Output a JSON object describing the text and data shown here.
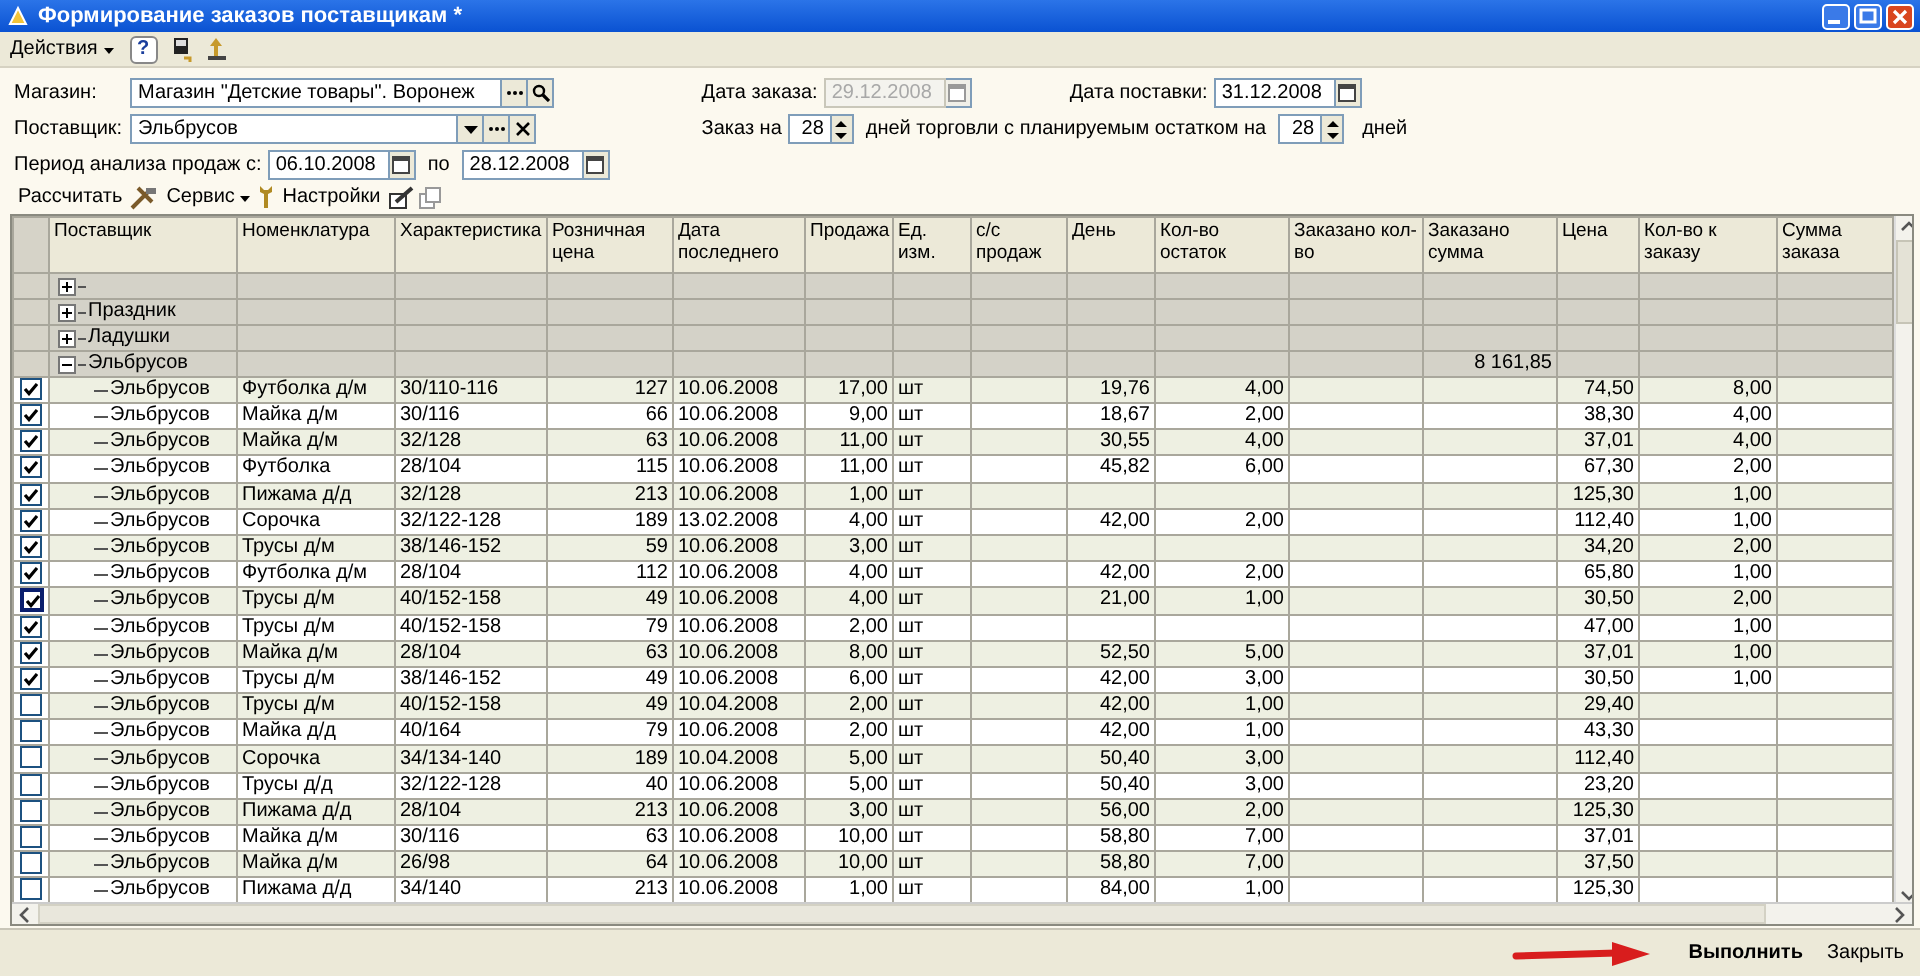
{
  "window": {
    "title": "Формирование заказов поставщикам *"
  },
  "menu": {
    "actions": "Действия",
    "help": "?"
  },
  "form": {
    "store": {
      "label": "Магазин:",
      "value": "Магазин \"Детские товары\". Воронеж"
    },
    "supplier": {
      "label": "Поставщик:",
      "value": "Эльбрусов"
    },
    "period": {
      "label": "Период анализа продаж с:",
      "from": "06.10.2008",
      "to_label": "по",
      "to": "28.12.2008"
    },
    "order_date": {
      "label": "Дата заказа:",
      "value": "29.12.2008",
      "disabled": true
    },
    "delivery_date": {
      "label": "Дата поставки:",
      "value": "31.12.2008",
      "disabled": false
    },
    "order_days": {
      "label": "Заказ на",
      "value": "28",
      "middle": "дней торговли с планируемым остатком на",
      "stock_days": "28",
      "suffix": "дней"
    }
  },
  "toolbar": {
    "calculate": "Рассчитать",
    "service": "Сервис",
    "settings": "Настройки"
  },
  "table": {
    "columns": [
      {
        "label": "Поставщик",
        "kind": "text"
      },
      {
        "label": "Номенклатура",
        "kind": "text"
      },
      {
        "label": "Характеристика",
        "kind": "text"
      },
      {
        "label": "Розничная цена",
        "kind": "number"
      },
      {
        "label": "Дата последнего",
        "kind": "text"
      },
      {
        "label": "Продажа",
        "kind": "number"
      },
      {
        "label": "Ед. изм.",
        "kind": "text"
      },
      {
        "label": "с/с продаж",
        "kind": "number"
      },
      {
        "label": "День",
        "kind": "number"
      },
      {
        "label": "Кол-во остаток",
        "kind": "number"
      },
      {
        "label": "Заказано кол-во",
        "kind": "number"
      },
      {
        "label": "Заказано сумма",
        "kind": "number"
      },
      {
        "label": "Цена",
        "kind": "number"
      },
      {
        "label": "Кол-во к заказу",
        "kind": "number"
      },
      {
        "label": "Сумма заказа",
        "kind": "number"
      }
    ],
    "groups": [
      {
        "expanded": false
      },
      {
        "label": "Праздник",
        "expanded": false
      },
      {
        "label": "Ладушки",
        "expanded": false
      },
      {
        "label": "Эльбрусов",
        "expanded": true,
        "ordered_sum": "8 161,85",
        "children": [
          {
            "checked": true,
            "focused": false,
            "cells": [
              "Эльбрусов",
              "Футболка д/м",
              "30/110-116",
              "127",
              "10.06.2008",
              "17,00",
              "шт",
              null,
              "19,76",
              "4,00",
              null,
              null,
              "74,50",
              "8,00",
              null
            ]
          },
          {
            "checked": true,
            "focused": false,
            "cells": [
              "Эльбрусов",
              "Майка д/м",
              "30/116",
              "66",
              "10.06.2008",
              "9,00",
              "шт",
              null,
              "18,67",
              "2,00",
              null,
              null,
              "38,30",
              "4,00",
              null
            ]
          },
          {
            "checked": true,
            "focused": false,
            "cells": [
              "Эльбрусов",
              "Майка д/м",
              "32/128",
              "63",
              "10.06.2008",
              "11,00",
              "шт",
              null,
              "30,55",
              "4,00",
              null,
              null,
              "37,01",
              "4,00",
              null
            ]
          },
          {
            "checked": true,
            "focused": false,
            "cells": [
              "Эльбрусов",
              "Футболка",
              "28/104",
              "115",
              "10.06.2008",
              "11,00",
              "шт",
              null,
              "45,82",
              "6,00",
              null,
              null,
              "67,30",
              "2,00",
              null
            ]
          },
          {
            "checked": true,
            "focused": false,
            "cells": [
              "Эльбрусов",
              "Пижама д/д",
              "32/128",
              "213",
              "10.06.2008",
              "1,00",
              "шт",
              null,
              null,
              null,
              null,
              null,
              "125,30",
              "1,00",
              null
            ]
          },
          {
            "checked": true,
            "focused": false,
            "cells": [
              "Эльбрусов",
              "Сорочка",
              "32/122-128",
              "189",
              "13.02.2008",
              "4,00",
              "шт",
              null,
              "42,00",
              "2,00",
              null,
              null,
              "112,40",
              "1,00",
              null
            ]
          },
          {
            "checked": true,
            "focused": false,
            "cells": [
              "Эльбрусов",
              "Трусы д/м",
              "38/146-152",
              "59",
              "10.06.2008",
              "3,00",
              "шт",
              null,
              null,
              null,
              null,
              null,
              "34,20",
              "2,00",
              null
            ]
          },
          {
            "checked": true,
            "focused": false,
            "cells": [
              "Эльбрусов",
              "Футболка д/м",
              "28/104",
              "112",
              "10.06.2008",
              "4,00",
              "шт",
              null,
              "42,00",
              "2,00",
              null,
              null,
              "65,80",
              "1,00",
              null
            ]
          },
          {
            "checked": true,
            "focused": true,
            "cells": [
              "Эльбрусов",
              "Трусы д/м",
              "40/152-158",
              "49",
              "10.06.2008",
              "4,00",
              "шт",
              null,
              "21,00",
              "1,00",
              null,
              null,
              "30,50",
              "2,00",
              null
            ]
          },
          {
            "checked": true,
            "focused": false,
            "cells": [
              "Эльбрусов",
              "Трусы д/м",
              "40/152-158",
              "79",
              "10.06.2008",
              "2,00",
              "шт",
              null,
              null,
              null,
              null,
              null,
              "47,00",
              "1,00",
              null
            ]
          },
          {
            "checked": true,
            "focused": false,
            "cells": [
              "Эльбрусов",
              "Майка д/м",
              "28/104",
              "63",
              "10.06.2008",
              "8,00",
              "шт",
              null,
              "52,50",
              "5,00",
              null,
              null,
              "37,01",
              "1,00",
              null
            ]
          },
          {
            "checked": true,
            "focused": false,
            "cells": [
              "Эльбрусов",
              "Трусы д/м",
              "38/146-152",
              "49",
              "10.06.2008",
              "6,00",
              "шт",
              null,
              "42,00",
              "3,00",
              null,
              null,
              "30,50",
              "1,00",
              null
            ]
          },
          {
            "checked": false,
            "focused": false,
            "cells": [
              "Эльбрусов",
              "Трусы д/м",
              "40/152-158",
              "49",
              "10.04.2008",
              "2,00",
              "шт",
              null,
              "42,00",
              "1,00",
              null,
              null,
              "29,40",
              null,
              null
            ]
          },
          {
            "checked": false,
            "focused": false,
            "cells": [
              "Эльбрусов",
              "Майка д/д",
              "40/164",
              "79",
              "10.06.2008",
              "2,00",
              "шт",
              null,
              "42,00",
              "1,00",
              null,
              null,
              "43,30",
              null,
              null
            ]
          },
          {
            "checked": false,
            "focused": false,
            "cells": [
              "Эльбрусов",
              "Сорочка",
              "34/134-140",
              "189",
              "10.04.2008",
              "5,00",
              "шт",
              null,
              "50,40",
              "3,00",
              null,
              null,
              "112,40",
              null,
              null
            ]
          },
          {
            "checked": false,
            "focused": false,
            "cells": [
              "Эльбрусов",
              "Трусы д/д",
              "32/122-128",
              "40",
              "10.06.2008",
              "5,00",
              "шт",
              null,
              "50,40",
              "3,00",
              null,
              null,
              "23,20",
              null,
              null
            ]
          },
          {
            "checked": false,
            "focused": false,
            "cells": [
              "Эльбрусов",
              "Пижама д/д",
              "28/104",
              "213",
              "10.06.2008",
              "3,00",
              "шт",
              null,
              "56,00",
              "2,00",
              null,
              null,
              "125,30",
              null,
              null
            ]
          },
          {
            "checked": false,
            "focused": false,
            "cells": [
              "Эльбрусов",
              "Майка д/м",
              "30/116",
              "63",
              "10.06.2008",
              "10,00",
              "шт",
              null,
              "58,80",
              "7,00",
              null,
              null,
              "37,01",
              null,
              null
            ]
          },
          {
            "checked": false,
            "focused": false,
            "cells": [
              "Эльбрусов",
              "Майка д/м",
              "26/98",
              "64",
              "10.06.2008",
              "10,00",
              "шт",
              null,
              "58,80",
              "7,00",
              null,
              null,
              "37,50",
              null,
              null
            ]
          },
          {
            "checked": false,
            "focused": false,
            "cells": [
              "Эльбрусов",
              "Пижама д/д",
              "34/140",
              "213",
              "10.06.2008",
              "1,00",
              "шт",
              null,
              "84,00",
              "1,00",
              null,
              null,
              "125,30",
              null,
              null
            ]
          }
        ]
      }
    ]
  },
  "buttons": [
    {
      "label": "Выполнить",
      "default": true
    },
    {
      "label": "Закрыть",
      "default": false
    }
  ]
}
